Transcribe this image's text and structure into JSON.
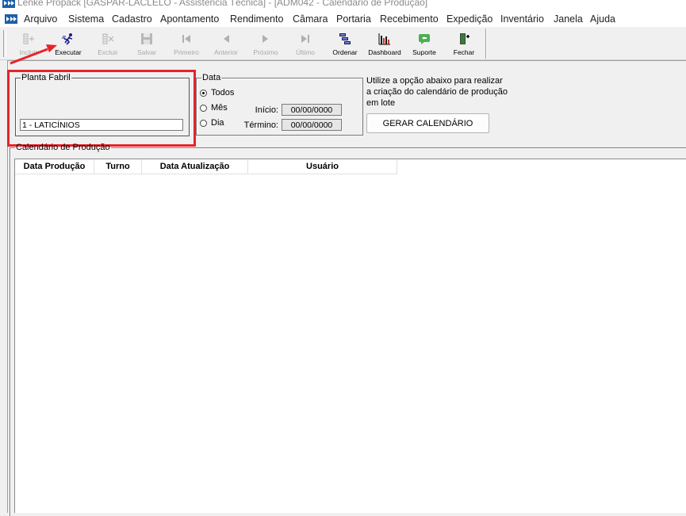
{
  "window": {
    "title": "Lenke Propack [GASPAR-LACLELO - Assistência Técnica] - [ADM042 - Calendário de Produção]"
  },
  "menu": {
    "items": [
      "Arquivo",
      "Sistema",
      "Cadastro",
      "Apontamento",
      "Rendimento",
      "Câmara",
      "Portaria",
      "Recebimento",
      "Expedição",
      "Inventário",
      "Janela",
      "Ajuda"
    ]
  },
  "toolbar": {
    "buttons": [
      {
        "label": "Incluir",
        "icon": "add-record-icon",
        "enabled": false
      },
      {
        "label": "Executar",
        "icon": "run-icon",
        "enabled": true
      },
      {
        "label": "Excluir",
        "icon": "delete-record-icon",
        "enabled": false
      },
      {
        "label": "Salvar",
        "icon": "save-icon",
        "enabled": false
      },
      {
        "label": "Primeiro",
        "icon": "first-record-icon",
        "enabled": false
      },
      {
        "label": "Anterior",
        "icon": "previous-icon",
        "enabled": false
      },
      {
        "label": "Próximo",
        "icon": "next-icon",
        "enabled": false
      },
      {
        "label": "Último",
        "icon": "last-record-icon",
        "enabled": false
      },
      {
        "label": "Ordenar",
        "icon": "sort-icon",
        "enabled": true
      },
      {
        "label": "Dashboard",
        "icon": "dashboard-chart-icon",
        "enabled": true
      },
      {
        "label": "Suporte",
        "icon": "support-icon",
        "enabled": true
      },
      {
        "label": "Fechar",
        "icon": "close-door-icon",
        "enabled": true
      }
    ]
  },
  "planta": {
    "legend": "Planta Fabril",
    "value": "1 - LATICÍNIOS"
  },
  "data_filter": {
    "legend": "Data",
    "options": [
      "Todos",
      "Mês",
      "Dia"
    ],
    "selected": "Todos",
    "inicio_label": "Início:",
    "inicio_value": "00/00/0000",
    "termino_label": "Término:",
    "termino_value": "00/00/0000"
  },
  "hint": {
    "text": "Utilize a opção abaixo para realizar a criação do calendário de produção em lote"
  },
  "gerar_button": {
    "label": "GERAR CALENDÁRIO"
  },
  "calendario": {
    "legend": "Calendário de Produção",
    "columns": [
      "Data Produção",
      "Turno",
      "Data Atualização",
      "Usuário"
    ],
    "rows": []
  },
  "colors": {
    "highlight_border": "#e8232a",
    "annotation_arrow": "#e8232a"
  }
}
